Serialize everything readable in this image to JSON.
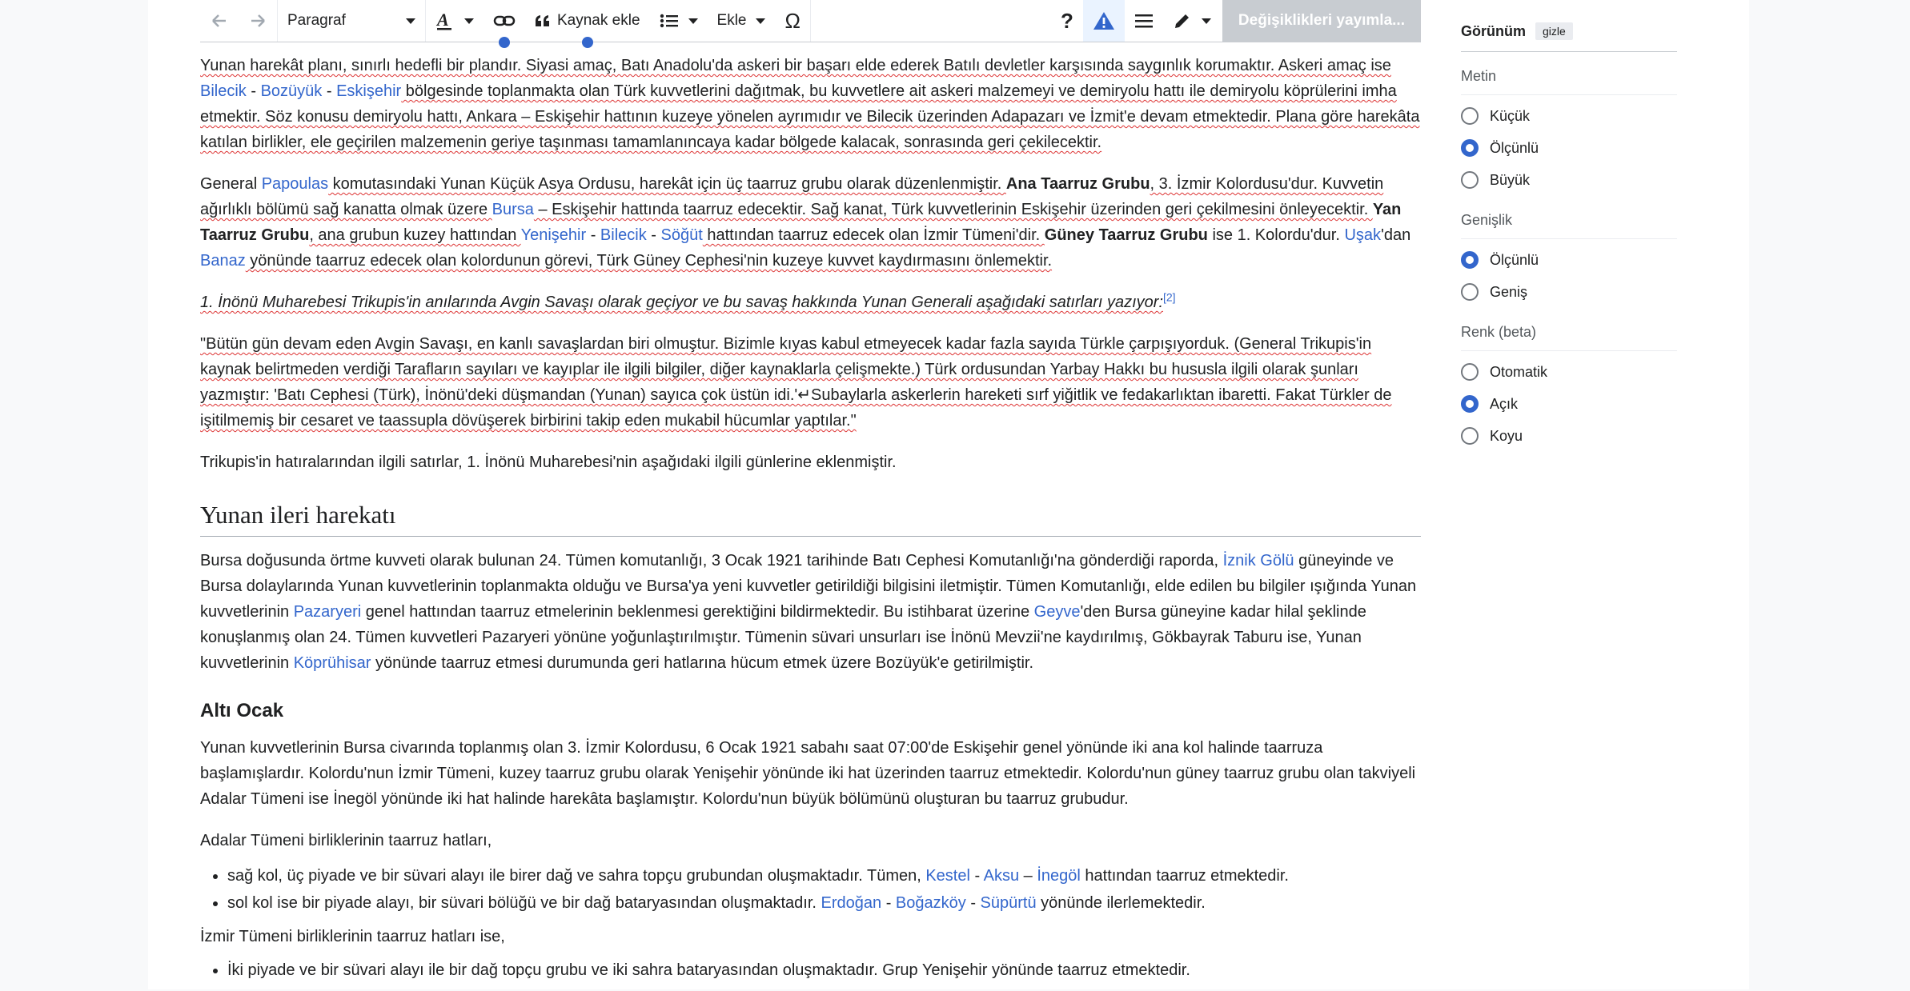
{
  "toolbar": {
    "paragraph": "Paragraf",
    "cite": "Kaynak ekle",
    "insert": "Ekle",
    "publish": "Değişiklikleri yayımla..."
  },
  "content": {
    "p1": {
      "t1": "Yunan harekât planı, sınırlı hedefli bir plandır. Siyasi amaç, Batı Anadolu'da askeri bir başarı elde ederek Batılı devletler karşısında saygınlık korumaktır. Askeri amaç ise ",
      "l1": "Bilecik",
      "s1": " - ",
      "l2": "Bozüyük",
      "s2": " - ",
      "l3": "Eskişehir",
      "t2": " bölgesinde toplanmakta olan Türk kuvvetlerini dağıtmak, bu kuvvetlere ait askeri malzemeyi ve demiryolu hattı ile demiryolu köprülerini imha etmektir. Söz konusu demiryolu hattı, Ankara – Eskişehir hattının kuzeye yönelen ayrımıdır ve Bilecik üzerinden Adapazarı ve İzmit'e devam etmektedir. Plana göre harekâta katılan birlikler, ele geçirilen malzemenin geriye taşınması tamamlanıncaya kadar bölgede kalacak, sonrasında geri çekilecektir."
    },
    "p2": {
      "t1": "General ",
      "l1": "Papoulas",
      "t2": " komutasındaki Yunan Küçük Asya Ordusu, harekât için üç taarruz grubu olarak düzenlenmiştir. ",
      "b1": "Ana Taarruz Grubu",
      "t3": ", 3. İzmir Kolordusu'dur. Kuvvetin ağırlıklı bölümü sağ kanatta olmak üzere ",
      "l2": "Bursa",
      "t4": " – Eskişehir hattında taarruz edecektir. Sağ kanat, Türk kuvvetlerinin Eskişehir üzerinden geri çekilmesini önleyecektir. ",
      "b2": "Yan Taarruz Grubu",
      "t5": ", ana grubun kuzey hattından ",
      "l3": "Yenişehir",
      "s1": " - ",
      "l4": "Bilecik",
      "s2": " - ",
      "l5": "Söğüt",
      "t6": " hattından taarruz edecek olan İzmir Tümeni'dir. ",
      "b3": "Güney Taarruz Grubu",
      "t7": " ise 1. Kolordu'dur. ",
      "l6": "Uşak",
      "t8": "'dan ",
      "l7": "Banaz",
      "t9": " yönünde taarruz edecek olan kolordunun görevi, Türk Güney Cephesi'nin kuzeye kuvvet kaydırmasını önlemektir."
    },
    "p3": {
      "t1": "1. İnönü Muharebesi Trikupis'in anılarında Avgin Savaşı olarak geçiyor ve bu savaş hakkında Yunan Generali aşağıdaki satırları yazıyor:",
      "ref": "[2]"
    },
    "p4": "\"Bütün gün devam eden Avgin Savaşı, en kanlı savaşlardan biri olmuştur. Bizimle kıyas kabul etmeyecek kadar fazla sayıda Türkle çarpışıyorduk. (General Trikupis'in kaynak belirtmeden verdiği Tarafların sayıları ve kayıplar ile ilgili bilgiler, diğer kaynaklarla çelişmekte.) Türk ordusundan Yarbay Hakkı bu hususla ilgili olarak şunları yazmıştır: 'Batı Cephesi (Türk), İnönü'deki düşmandan (Yunan) sayıca çok üstün idi.'↵Subaylarla askerlerin hareketi sırf yiğitlik ve fedakarlıktan ibaretti. Fakat Türkler de işitilmemiş bir cesaret ve taassupla dövüşerek birbirini takip eden mukabil hücumlar yaptılar.\"",
    "p5": "Trikupis'in hatıralarından ilgili satırlar, 1. İnönü Muharebesi'nin aşağıdaki ilgili günlerine eklenmiştir.",
    "h2": "Yunan ileri harekatı",
    "p6": {
      "t1": "Bursa doğusunda örtme kuvveti olarak bulunan 24. Tümen komutanlığı, 3 Ocak 1921 tarihinde Batı Cephesi Komutanlığı'na gönderdiği raporda, ",
      "l1": "İznik Gölü",
      "t2": " güneyinde ve Bursa dolaylarında Yunan kuvvetlerinin toplanmakta olduğu ve Bursa'ya yeni kuvvetler getirildiği bilgisini iletmiştir. Tümen Komutanlığı, elde edilen bu bilgiler ışığında Yunan kuvvetlerinin ",
      "l2": "Pazaryeri",
      "t3": " genel hattından taarruz etmelerinin beklenmesi gerektiğini bildirmektedir. Bu istihbarat üzerine ",
      "l3": "Geyve",
      "t4": "'den Bursa güneyine kadar hilal şeklinde konuşlanmış olan 24. Tümen kuvvetleri Pazaryeri yönüne yoğunlaştırılmıştır. Tümenin süvari unsurları ise İnönü Mevzii'ne kaydırılmış, Gökbayrak Taburu ise, Yunan kuvvetlerinin ",
      "l4": "Köprühisar",
      "t5": " yönünde taarruz etmesi durumunda geri hatlarına hücum etmek üzere Bozüyük'e getirilmiştir."
    },
    "h3": "Altı Ocak",
    "p7": "Yunan kuvvetlerinin Bursa civarında toplanmış olan 3. İzmir Kolordusu, 6 Ocak 1921 sabahı saat 07:00'de Eskişehir genel yönünde iki ana kol halinde taarruza başlamışlardır. Kolordu'nun İzmir Tümeni, kuzey taarruz grubu olarak Yenişehir yönünde iki hat üzerinden taarruz etmektedir. Kolordu'nun güney taarruz grubu olan takviyeli Adalar Tümeni ise İnegöl yönünde iki hat halinde harekâta başlamıştır. Kolordu'nun büyük bölümünü oluşturan bu taarruz grubudur.",
    "p8": "Adalar Tümeni birliklerinin taarruz hatları,",
    "li1": {
      "t1": "sağ kol, üç piyade ve bir süvari alayı ile birer dağ ve sahra topçu grubundan oluşmaktadır. Tümen, ",
      "l1": "Kestel",
      "s1": " - ",
      "l2": "Aksu",
      "s2": " – ",
      "l3": "İnegöl",
      "t2": " hattından taarruz etmektedir."
    },
    "li2": {
      "t1": "sol kol ise bir piyade alayı, bir süvari bölüğü ve bir dağ bataryasından oluşmaktadır. ",
      "l1": "Erdoğan",
      "s1": " - ",
      "l2": "Boğazköy",
      "s2": " - ",
      "l3": "Süpürtü",
      "t2": " yönünde ilerlemektedir."
    },
    "p9": "İzmir Tümeni birliklerinin taarruz hatları ise,",
    "li3": "İki piyade ve bir süvari alayı ile bir dağ topçu grubu ve iki sahra bataryasından oluşmaktadır. Grup Yenişehir yönünde taarruz etmektedir."
  },
  "sidebar": {
    "title": "Görünüm",
    "hide": "gizle",
    "text_label": "Metin",
    "text_options": [
      "Küçük",
      "Ölçünlü",
      "Büyük"
    ],
    "text_selected": 1,
    "width_label": "Genişlik",
    "width_options": [
      "Ölçünlü",
      "Geniş"
    ],
    "width_selected": 0,
    "color_label": "Renk (beta)",
    "color_options": [
      "Otomatik",
      "Açık",
      "Koyu"
    ],
    "color_selected": 1
  },
  "colors": {
    "link": "#3366cc",
    "accent": "#3366cc",
    "publish_disabled": "#c8ccd1"
  }
}
